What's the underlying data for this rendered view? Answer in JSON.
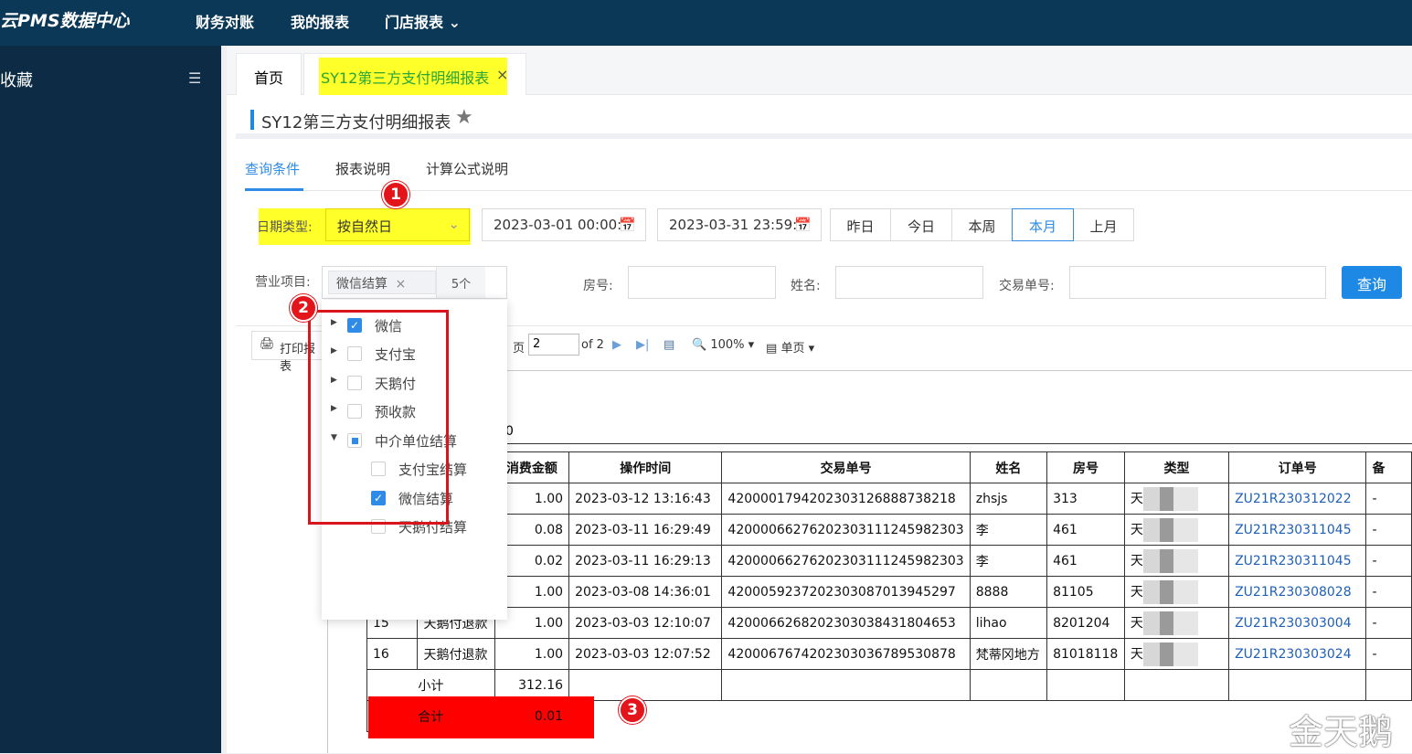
{
  "topbar": {
    "brand": "云PMS数据中心",
    "nav": [
      "财务对账",
      "我的报表",
      "门店报表"
    ],
    "nav_dropdown_icon": "chevron-down-icon"
  },
  "sidebar": {
    "title": "收藏",
    "collapse_icon": "menu-collapse-icon"
  },
  "tabs": [
    {
      "label": "首页"
    },
    {
      "label": "SY12第三方支付明细报表",
      "close": "×"
    }
  ],
  "page": {
    "title": "SY12第三方支付明细报表",
    "star": "★"
  },
  "query_tabs": [
    "查询条件",
    "报表说明",
    "计算公式说明"
  ],
  "filters": {
    "date_type_label": "日期类型:",
    "date_type_value": "按自然日",
    "start_date": "2023-03-01 00:00:0",
    "end_date": "2023-03-31 23:59:5",
    "quick_ranges": [
      "昨日",
      "今日",
      "本周",
      "本月",
      "上月"
    ],
    "active_range": "本月",
    "business_label": "营业项目:",
    "business_tag": "微信结算",
    "business_count": "5个",
    "room_label": "房号:",
    "name_label": "姓名:",
    "trade_label": "交易单号:",
    "query_button": "查询"
  },
  "dropdown_tree": [
    {
      "label": "微信",
      "checked": true
    },
    {
      "label": "支付宝",
      "checked": false
    },
    {
      "label": "天鹅付",
      "checked": false
    },
    {
      "label": "预收款",
      "checked": false
    },
    {
      "label": "中介单位结算",
      "partial": true
    },
    {
      "label": "支付宝结算",
      "checked": false
    },
    {
      "label": "微信结算",
      "checked": true
    },
    {
      "label": "天鹅付结算",
      "checked": false
    }
  ],
  "toolbar": {
    "print_label": "打印报表",
    "page_label": "页",
    "page_value": "2",
    "page_of": "of 2",
    "zoom": "100%",
    "view_mode": "单页",
    "partial_text": "0"
  },
  "table": {
    "headers": [
      "消费金额",
      "操作时间",
      "交易单号",
      "姓名",
      "房号",
      "类型",
      "订单号",
      "备"
    ],
    "rows": [
      [
        "",
        "",
        "1.00",
        "2023-03-12 13:16:43",
        "4200001794202303126888738218",
        "zhsjs",
        "313",
        "天",
        "ZU21R230312022",
        "-"
      ],
      [
        "",
        "",
        "0.08",
        "2023-03-11 16:29:49",
        "4200006627620230311124598230​3",
        "李",
        "461",
        "天",
        "ZU21R230311045",
        "-"
      ],
      [
        "",
        "",
        "0.02",
        "2023-03-11 16:29:13",
        "4200006627620230311124598230​3",
        "李",
        "461",
        "天",
        "ZU21R230311045",
        "-"
      ],
      [
        "",
        "",
        "1.00",
        "2023-03-08 14:36:01",
        "4200059237202303087013945297",
        "8888",
        "81105",
        "天",
        "ZU21R230308028",
        "-"
      ],
      [
        "15",
        "天鹅付退款",
        "1.00",
        "2023-03-03 12:10:07",
        "4200066268202303038431804653",
        "lihao",
        "8201204",
        "天",
        "ZU21R230303004",
        "-"
      ],
      [
        "16",
        "天鹅付退款",
        "1.00",
        "2023-03-03 12:07:52",
        "4200067674202303036789530878",
        "梵蒂冈地方",
        "81018118",
        "天",
        "ZU21R230303024",
        "-"
      ]
    ],
    "subtotal_label": "小计",
    "subtotal_value": "312.16",
    "total_label": "合计",
    "total_value": "0.01"
  },
  "annotations": [
    "1",
    "2",
    "3"
  ],
  "watermark": "金天鹅"
}
